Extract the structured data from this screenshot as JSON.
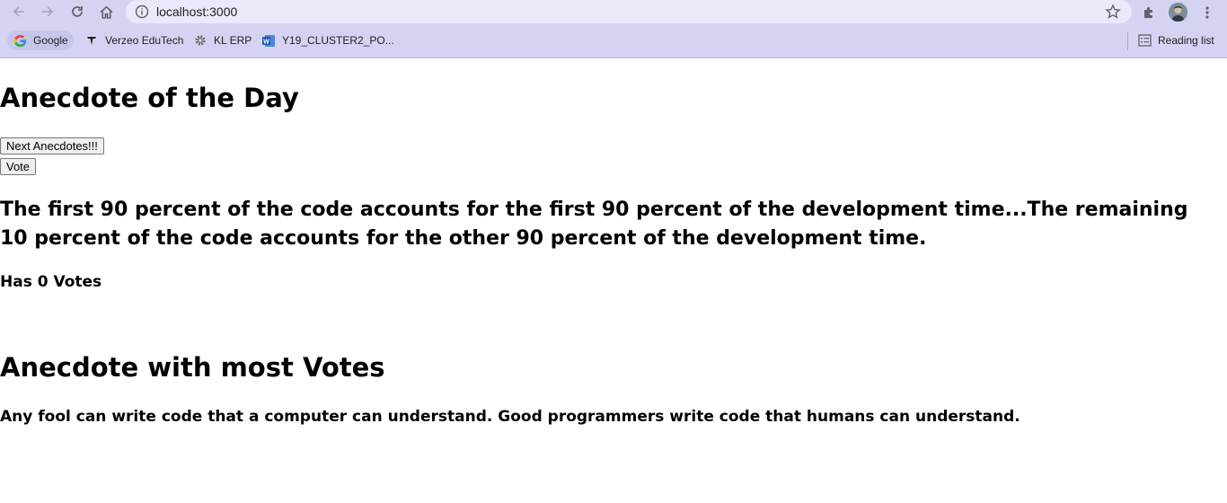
{
  "browser": {
    "url": "localhost:3000",
    "bookmarks": [
      {
        "label": "Google",
        "icon": "google-icon"
      },
      {
        "label": "Verzeo EduTech",
        "icon": "verzeo-icon"
      },
      {
        "label": "KL ERP",
        "icon": "gear-icon"
      },
      {
        "label": "Y19_CLUSTER2_PO...",
        "icon": "word-doc-icon"
      }
    ],
    "reading_list_label": "Reading list"
  },
  "app": {
    "title": "Anecdote of the Day",
    "next_button": "Next Anecdotes!!!",
    "vote_button": "Vote",
    "current_anecdote": "The first 90 percent of the code accounts for the first 90 percent of the development time...The remaining 10 percent of the code accounts for the other 90 percent of the development time.",
    "votes_text": "Has 0 Votes",
    "most_votes_title": "Anecdote with most Votes",
    "most_votes_anecdote": "Any fool can write code that a computer can understand. Good programmers write code that humans can understand."
  }
}
